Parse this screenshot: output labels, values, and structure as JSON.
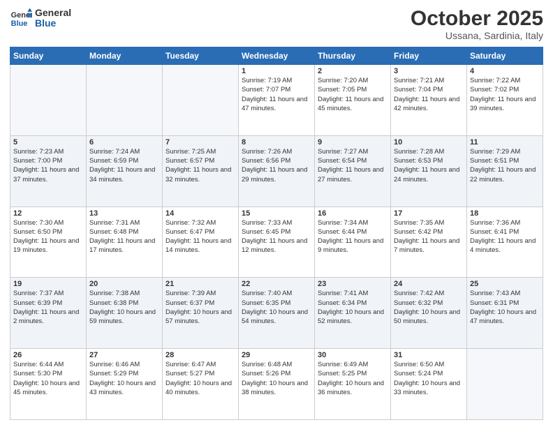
{
  "header": {
    "logo_general": "General",
    "logo_blue": "Blue",
    "month": "October 2025",
    "location": "Ussana, Sardinia, Italy"
  },
  "days_of_week": [
    "Sunday",
    "Monday",
    "Tuesday",
    "Wednesday",
    "Thursday",
    "Friday",
    "Saturday"
  ],
  "weeks": [
    [
      {
        "day": "",
        "info": ""
      },
      {
        "day": "",
        "info": ""
      },
      {
        "day": "",
        "info": ""
      },
      {
        "day": "1",
        "info": "Sunrise: 7:19 AM\nSunset: 7:07 PM\nDaylight: 11 hours and 47 minutes."
      },
      {
        "day": "2",
        "info": "Sunrise: 7:20 AM\nSunset: 7:05 PM\nDaylight: 11 hours and 45 minutes."
      },
      {
        "day": "3",
        "info": "Sunrise: 7:21 AM\nSunset: 7:04 PM\nDaylight: 11 hours and 42 minutes."
      },
      {
        "day": "4",
        "info": "Sunrise: 7:22 AM\nSunset: 7:02 PM\nDaylight: 11 hours and 39 minutes."
      }
    ],
    [
      {
        "day": "5",
        "info": "Sunrise: 7:23 AM\nSunset: 7:00 PM\nDaylight: 11 hours and 37 minutes."
      },
      {
        "day": "6",
        "info": "Sunrise: 7:24 AM\nSunset: 6:59 PM\nDaylight: 11 hours and 34 minutes."
      },
      {
        "day": "7",
        "info": "Sunrise: 7:25 AM\nSunset: 6:57 PM\nDaylight: 11 hours and 32 minutes."
      },
      {
        "day": "8",
        "info": "Sunrise: 7:26 AM\nSunset: 6:56 PM\nDaylight: 11 hours and 29 minutes."
      },
      {
        "day": "9",
        "info": "Sunrise: 7:27 AM\nSunset: 6:54 PM\nDaylight: 11 hours and 27 minutes."
      },
      {
        "day": "10",
        "info": "Sunrise: 7:28 AM\nSunset: 6:53 PM\nDaylight: 11 hours and 24 minutes."
      },
      {
        "day": "11",
        "info": "Sunrise: 7:29 AM\nSunset: 6:51 PM\nDaylight: 11 hours and 22 minutes."
      }
    ],
    [
      {
        "day": "12",
        "info": "Sunrise: 7:30 AM\nSunset: 6:50 PM\nDaylight: 11 hours and 19 minutes."
      },
      {
        "day": "13",
        "info": "Sunrise: 7:31 AM\nSunset: 6:48 PM\nDaylight: 11 hours and 17 minutes."
      },
      {
        "day": "14",
        "info": "Sunrise: 7:32 AM\nSunset: 6:47 PM\nDaylight: 11 hours and 14 minutes."
      },
      {
        "day": "15",
        "info": "Sunrise: 7:33 AM\nSunset: 6:45 PM\nDaylight: 11 hours and 12 minutes."
      },
      {
        "day": "16",
        "info": "Sunrise: 7:34 AM\nSunset: 6:44 PM\nDaylight: 11 hours and 9 minutes."
      },
      {
        "day": "17",
        "info": "Sunrise: 7:35 AM\nSunset: 6:42 PM\nDaylight: 11 hours and 7 minutes."
      },
      {
        "day": "18",
        "info": "Sunrise: 7:36 AM\nSunset: 6:41 PM\nDaylight: 11 hours and 4 minutes."
      }
    ],
    [
      {
        "day": "19",
        "info": "Sunrise: 7:37 AM\nSunset: 6:39 PM\nDaylight: 11 hours and 2 minutes."
      },
      {
        "day": "20",
        "info": "Sunrise: 7:38 AM\nSunset: 6:38 PM\nDaylight: 10 hours and 59 minutes."
      },
      {
        "day": "21",
        "info": "Sunrise: 7:39 AM\nSunset: 6:37 PM\nDaylight: 10 hours and 57 minutes."
      },
      {
        "day": "22",
        "info": "Sunrise: 7:40 AM\nSunset: 6:35 PM\nDaylight: 10 hours and 54 minutes."
      },
      {
        "day": "23",
        "info": "Sunrise: 7:41 AM\nSunset: 6:34 PM\nDaylight: 10 hours and 52 minutes."
      },
      {
        "day": "24",
        "info": "Sunrise: 7:42 AM\nSunset: 6:32 PM\nDaylight: 10 hours and 50 minutes."
      },
      {
        "day": "25",
        "info": "Sunrise: 7:43 AM\nSunset: 6:31 PM\nDaylight: 10 hours and 47 minutes."
      }
    ],
    [
      {
        "day": "26",
        "info": "Sunrise: 6:44 AM\nSunset: 5:30 PM\nDaylight: 10 hours and 45 minutes."
      },
      {
        "day": "27",
        "info": "Sunrise: 6:46 AM\nSunset: 5:29 PM\nDaylight: 10 hours and 43 minutes."
      },
      {
        "day": "28",
        "info": "Sunrise: 6:47 AM\nSunset: 5:27 PM\nDaylight: 10 hours and 40 minutes."
      },
      {
        "day": "29",
        "info": "Sunrise: 6:48 AM\nSunset: 5:26 PM\nDaylight: 10 hours and 38 minutes."
      },
      {
        "day": "30",
        "info": "Sunrise: 6:49 AM\nSunset: 5:25 PM\nDaylight: 10 hours and 36 minutes."
      },
      {
        "day": "31",
        "info": "Sunrise: 6:50 AM\nSunset: 5:24 PM\nDaylight: 10 hours and 33 minutes."
      },
      {
        "day": "",
        "info": ""
      }
    ]
  ]
}
